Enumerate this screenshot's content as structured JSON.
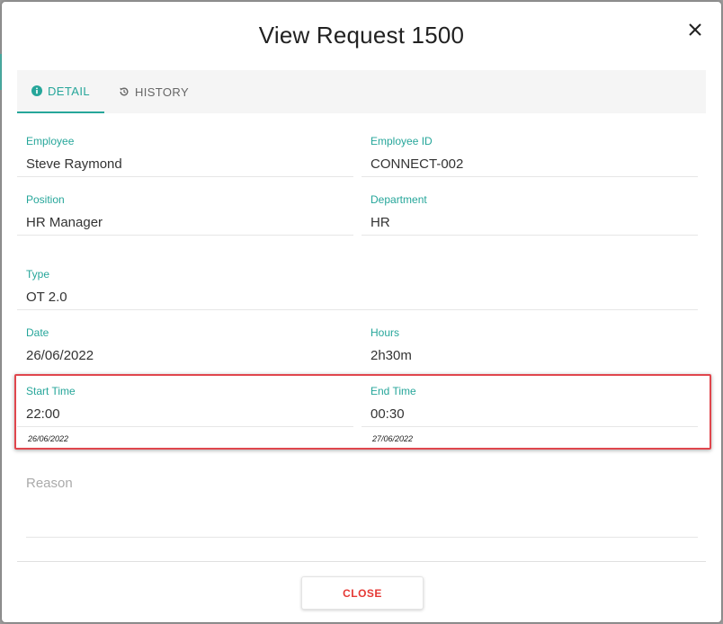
{
  "dialog": {
    "title": "View Request 1500"
  },
  "tabs": [
    {
      "label": "DETAIL",
      "icon": "info-circle-icon",
      "active": true
    },
    {
      "label": "HISTORY",
      "icon": "history-icon",
      "active": false
    }
  ],
  "fields": {
    "employee": {
      "label": "Employee",
      "value": "Steve Raymond"
    },
    "employee_id": {
      "label": "Employee ID",
      "value": "CONNECT-002"
    },
    "position": {
      "label": "Position",
      "value": "HR Manager"
    },
    "department": {
      "label": "Department",
      "value": "HR"
    },
    "type": {
      "label": "Type",
      "value": "OT 2.0"
    },
    "date": {
      "label": "Date",
      "value": "26/06/2022"
    },
    "hours": {
      "label": "Hours",
      "value": "2h30m"
    },
    "start_time": {
      "label": "Start Time",
      "value": "22:00",
      "date": "26/06/2022"
    },
    "end_time": {
      "label": "End Time",
      "value": "00:30",
      "date": "27/06/2022"
    },
    "reason": {
      "label": "Reason",
      "value": ""
    }
  },
  "footer": {
    "close_label": "CLOSE"
  },
  "colors": {
    "accent": "#26a69a",
    "highlight": "#e0464d",
    "close_text": "#e53935"
  }
}
